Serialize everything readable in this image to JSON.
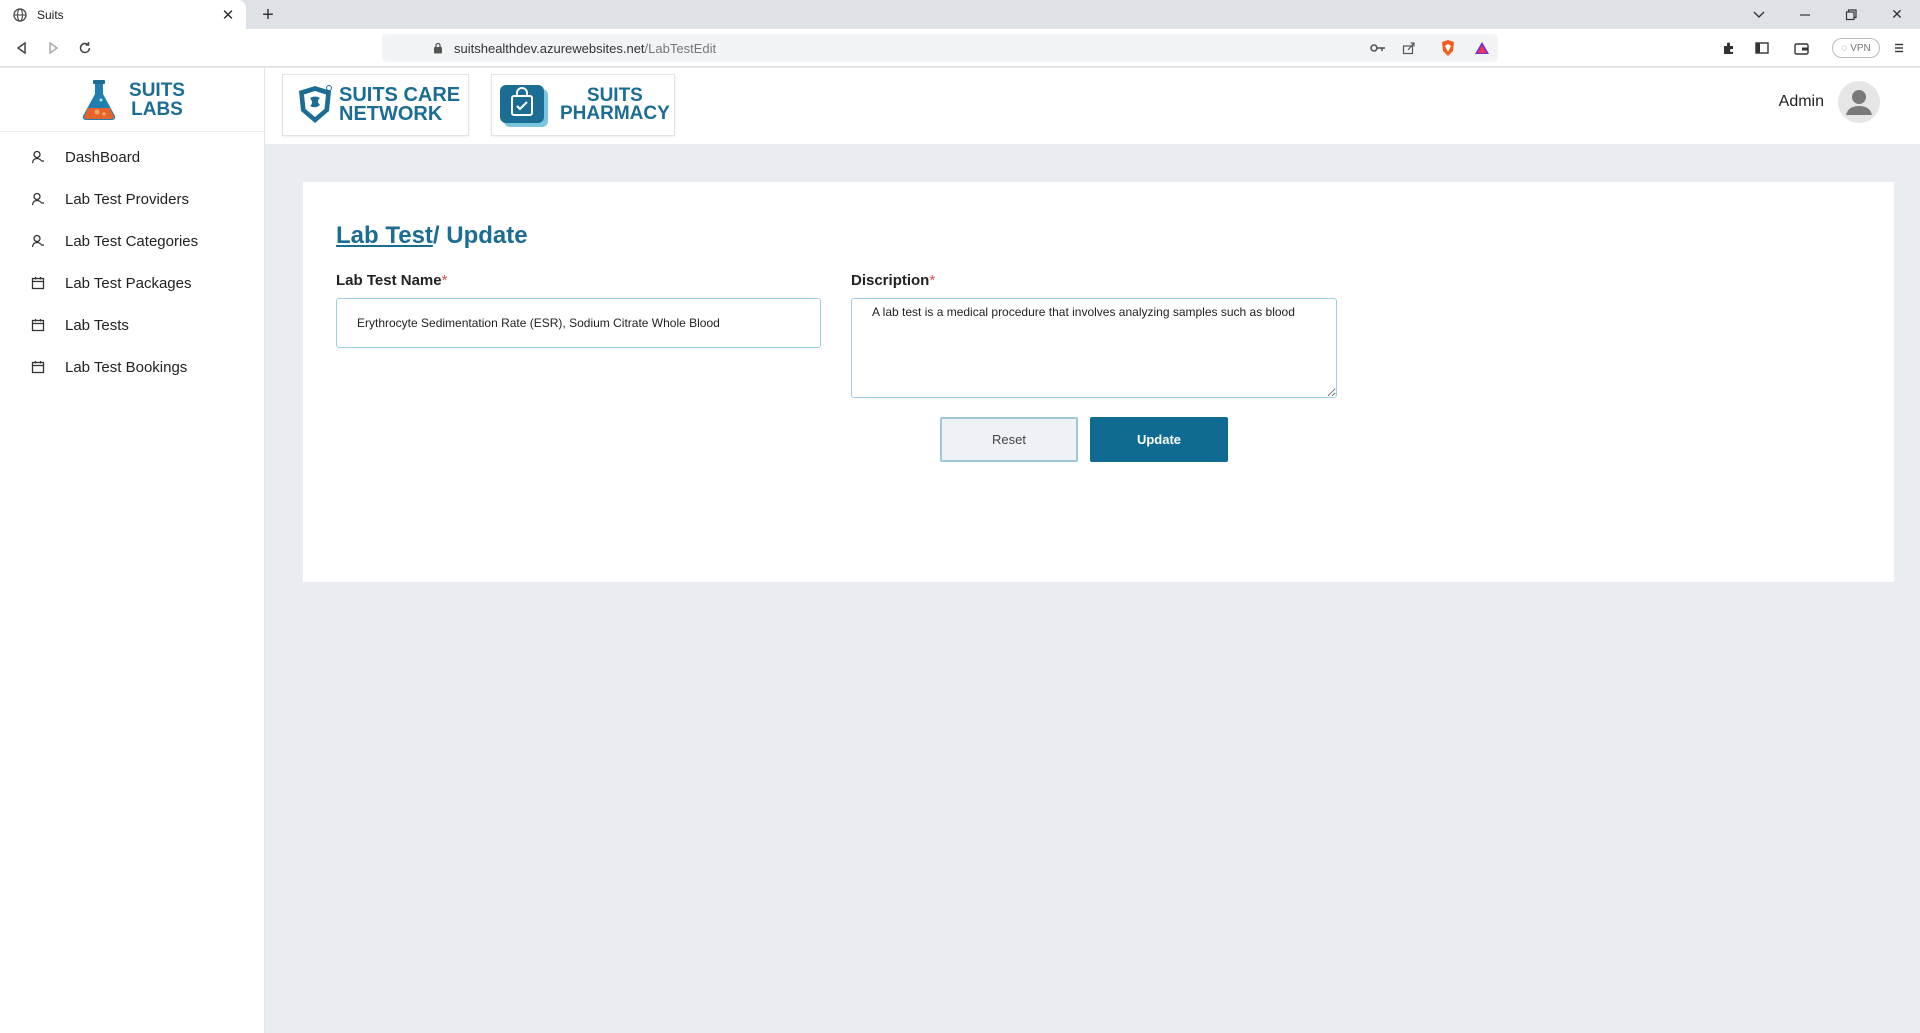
{
  "browser": {
    "tab_title": "Suits",
    "url_host": "suitshealthdev.azurewebsites.net",
    "url_path": "/LabTestEdit",
    "vpn_label": "VPN"
  },
  "brand": {
    "line1": "SUITS",
    "line2": "LABS"
  },
  "sidebar": {
    "items": [
      {
        "label": "DashBoard",
        "icon": "user-icon"
      },
      {
        "label": "Lab Test Providers",
        "icon": "user-icon"
      },
      {
        "label": "Lab Test Categories",
        "icon": "user-icon"
      },
      {
        "label": "Lab Test Packages",
        "icon": "calendar-icon"
      },
      {
        "label": "Lab Tests",
        "icon": "calendar-icon"
      },
      {
        "label": "Lab Test Bookings",
        "icon": "calendar-icon"
      }
    ]
  },
  "header": {
    "care_line1": "SUITS CARE",
    "care_line2": "NETWORK",
    "pharmacy_line1": "SUITS",
    "pharmacy_line2": "PHARMACY",
    "user_name": "Admin"
  },
  "form": {
    "breadcrumb_link": "Lab Test",
    "breadcrumb_rest": "/ Update",
    "name_label": "Lab Test Name",
    "name_value": "Erythrocyte Sedimentation Rate (ESR), Sodium Citrate Whole Blood",
    "desc_label": "Discription",
    "desc_value": "A lab test is a medical procedure that involves analyzing samples such as blood",
    "required_mark": "*",
    "reset_label": "Reset",
    "update_label": "Update"
  },
  "colors": {
    "brand_blue": "#1b6d94",
    "button_blue": "#0f6b91",
    "page_bg": "#e9ecf0"
  }
}
